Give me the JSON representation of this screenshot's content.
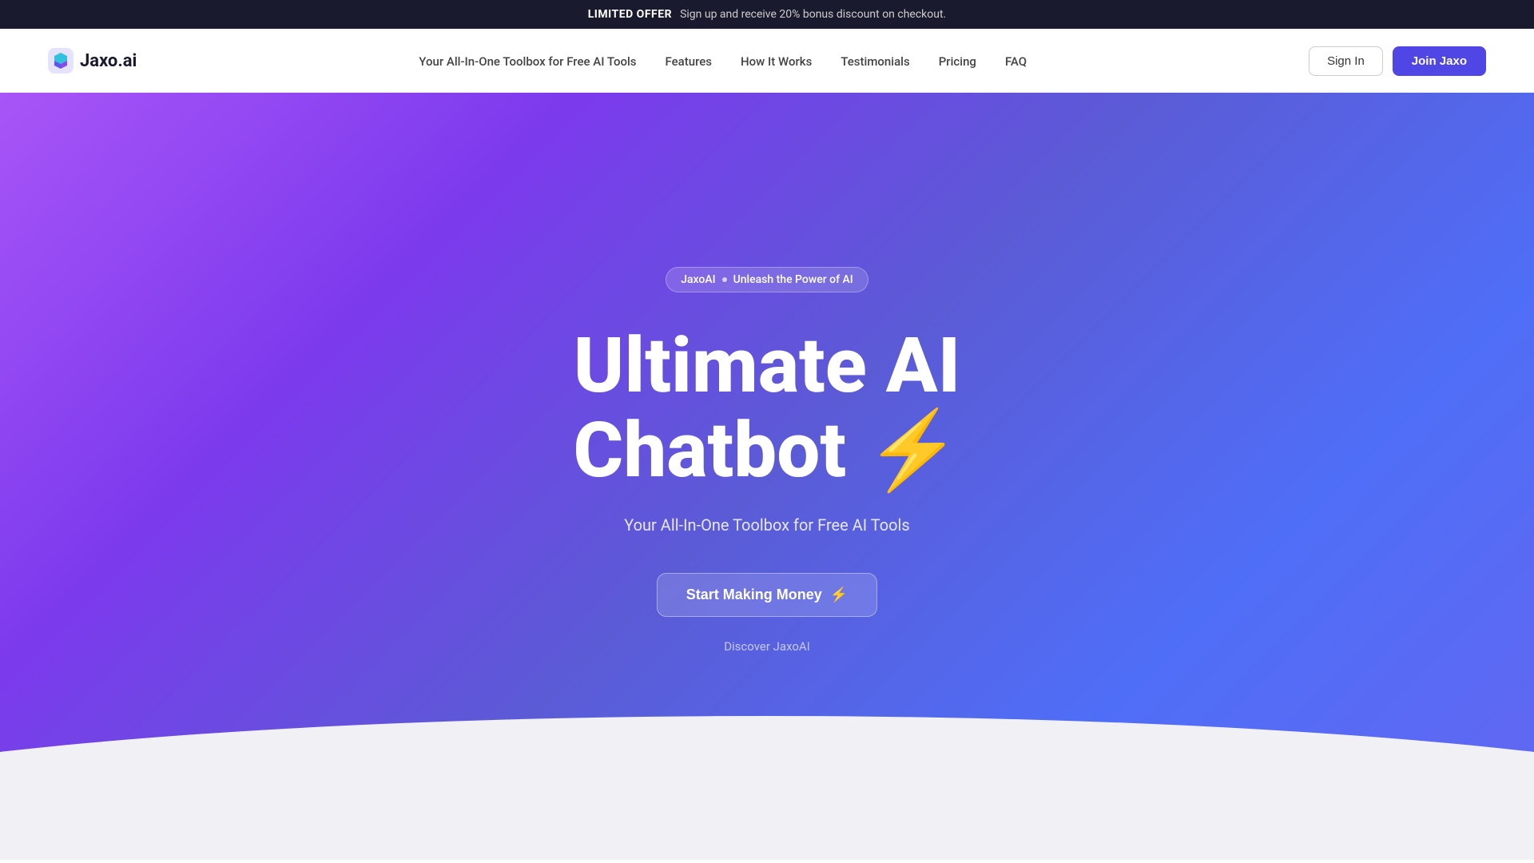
{
  "announcement": {
    "offer_label": "LIMITED OFFER",
    "offer_text": "Sign up and receive 20% bonus discount on checkout."
  },
  "navbar": {
    "logo_text": "Jaxo.ai",
    "nav_links": [
      {
        "id": "toolbox",
        "label": "Your All-In-One Toolbox for Free AI Tools"
      },
      {
        "id": "features",
        "label": "Features"
      },
      {
        "id": "how-it-works",
        "label": "How It Works"
      },
      {
        "id": "testimonials",
        "label": "Testimonials"
      },
      {
        "id": "pricing",
        "label": "Pricing"
      },
      {
        "id": "faq",
        "label": "FAQ"
      }
    ],
    "signin_label": "Sign In",
    "join_label": "Join Jaxo"
  },
  "hero": {
    "badge_brand": "JaxoAI",
    "badge_separator": "·",
    "badge_text": "Unleash the Power of AI",
    "title_line1": "Ultimate AI",
    "title_line2": "Chatbot",
    "lightning_emoji": "⚡",
    "subtitle": "Your All-In-One Toolbox for Free AI Tools",
    "cta_label": "Start Making Money",
    "cta_icon": "⚡",
    "discover_label": "Discover JaxoAI"
  },
  "colors": {
    "accent": "#4f46e5",
    "hero_gradient_start": "#a855f7",
    "hero_gradient_end": "#4f6ef7"
  }
}
